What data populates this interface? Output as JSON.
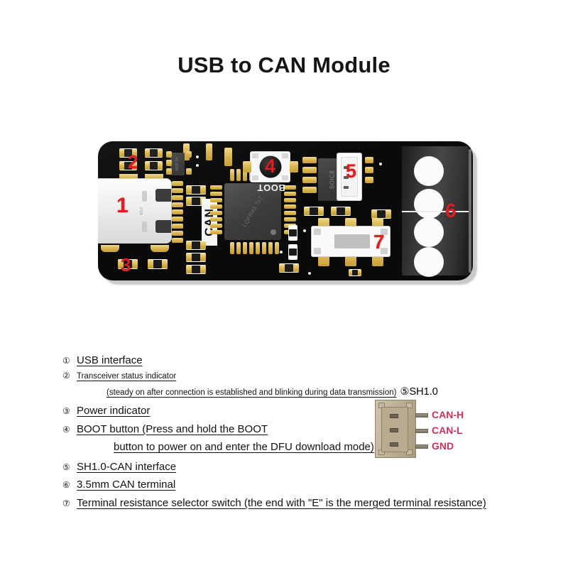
{
  "page": {
    "title": "USB to CAN Module",
    "background_color": "#ffffff",
    "marker_color": "#e01e21",
    "signal_label_color": "#c9345a"
  },
  "board": {
    "substrate_color": "#0a0a0a",
    "components": {
      "usb_connector": {
        "marker": "1",
        "logo_text": "USB"
      },
      "tx_status_led": {
        "marker": "2"
      },
      "power_led": {
        "marker": "3"
      },
      "boot_button": {
        "marker": "4",
        "silkscreen": "BOOT"
      },
      "sh10_connector": {
        "marker": "5"
      },
      "can_terminal": {
        "marker": "6"
      },
      "resistance_switch": {
        "marker": "7"
      },
      "mcu": {
        "label": "LQFP48 7x7"
      },
      "transceiver": {
        "label": "SOIC8"
      },
      "regulator": {
        "label": "662K-05"
      },
      "can_silkscreen": {
        "label": "CAN"
      }
    }
  },
  "legend": {
    "items": [
      {
        "num": "①",
        "text": "USB interface",
        "size": "lg"
      },
      {
        "num": "②",
        "text": "Transceiver status indicator ",
        "size": "sm"
      },
      {
        "num": "",
        "text": "(steady on after connection is established and blinking during data transmission)",
        "size": "sm",
        "continuation": true,
        "tail": "⑤SH1.0"
      },
      {
        "num": "③",
        "text": "Power indicator ",
        "size": "lg"
      },
      {
        "num": "④",
        "text": "BOOT button (Press and hold the BOOT",
        "size": "lg"
      },
      {
        "num": "",
        "text": "button to power on and enter the DFU download mode)",
        "size": "lg",
        "continuation2": true
      },
      {
        "num": "⑤",
        "text": "SH1.0-CAN interface",
        "size": "lg"
      },
      {
        "num": "⑥",
        "text": "3.5mm CAN terminal",
        "size": "lg"
      },
      {
        "num": "⑦",
        "text": "Terminal resistance selector switch (the end with \"E\" is the merged terminal resistance)",
        "size": "lg"
      }
    ]
  },
  "pinout": {
    "signals": [
      {
        "name": "CAN-H"
      },
      {
        "name": "CAN-L"
      },
      {
        "name": "GND"
      }
    ]
  }
}
